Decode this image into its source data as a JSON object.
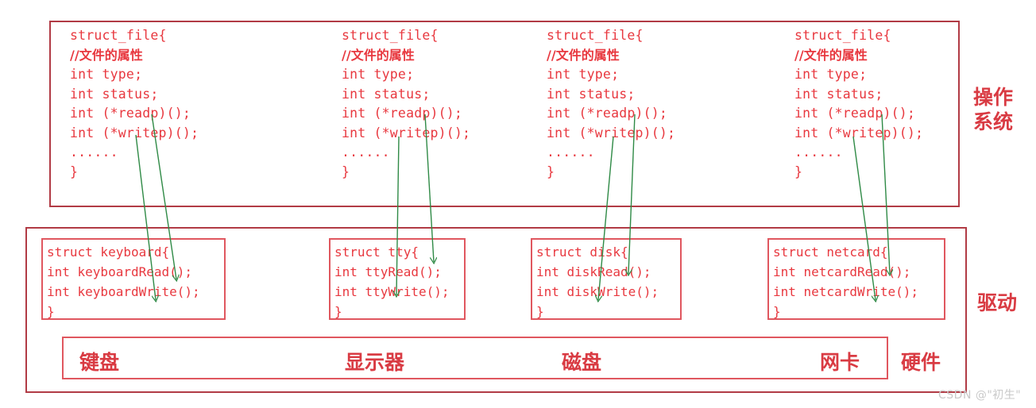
{
  "diagram": {
    "title_layers": {
      "os": "操作\n系统",
      "driver": "驱动",
      "hardware": "硬件"
    },
    "os_struct_lines": [
      "struct_file{",
      "//文件的属性",
      "int type;",
      "int status;",
      "int (*readp)();",
      "int (*writep)();",
      "......",
      "}"
    ],
    "os_blocks": [
      {
        "name": "struct-file-keyboard",
        "lines": [
          "struct_file{",
          "//文件的属性",
          "int type;",
          "int status;",
          "int (*readp)();",
          "int (*writep)();",
          "......",
          "}"
        ]
      },
      {
        "name": "struct-file-tty",
        "lines": [
          "struct_file{",
          "//文件的属性",
          "int type;",
          "int status;",
          "int (*readp)();",
          "int (*writep)();",
          "......",
          "}"
        ]
      },
      {
        "name": "struct-file-disk",
        "lines": [
          "struct_file{",
          "//文件的属性",
          "int type;",
          "int status;",
          "int (*readp)();",
          "int (*writep)();",
          "......",
          "}"
        ]
      },
      {
        "name": "struct-file-netcard",
        "lines": [
          "struct_file{",
          "//文件的属性",
          "int type;",
          "int status;",
          "int (*readp)();",
          "int (*writep)();",
          "......",
          "}"
        ]
      }
    ],
    "driver_blocks": [
      {
        "name": "struct-keyboard",
        "lines": [
          "struct keyboard{",
          "int keyboardRead();",
          "int keyboardWrite();",
          "}"
        ]
      },
      {
        "name": "struct-tty",
        "lines": [
          "struct tty{",
          "int ttyRead();",
          "int ttyWrite();",
          "}"
        ]
      },
      {
        "name": "struct-disk",
        "lines": [
          "struct disk{",
          "int diskRead();",
          "int diskWrite();",
          "}"
        ]
      },
      {
        "name": "struct-netcard",
        "lines": [
          "struct netcard{",
          "int netcardRead();",
          "int netcardWrite();",
          "}"
        ]
      }
    ],
    "hardware_items": [
      {
        "name": "hardware-keyboard",
        "label": "键盘"
      },
      {
        "name": "hardware-display",
        "label": "显示器"
      },
      {
        "name": "hardware-disk",
        "label": "磁盘"
      },
      {
        "name": "hardware-netcard",
        "label": "网卡"
      }
    ],
    "watermark": "CSDN @\"初生\"",
    "colors": {
      "text_red": "#e8383f",
      "border_red": "#b13b45",
      "inner_border_red": "#e0575f",
      "label_red": "#d93b43",
      "arrow_green": "#2f8a46",
      "watermark_grey": "#c9c9c9"
    }
  }
}
